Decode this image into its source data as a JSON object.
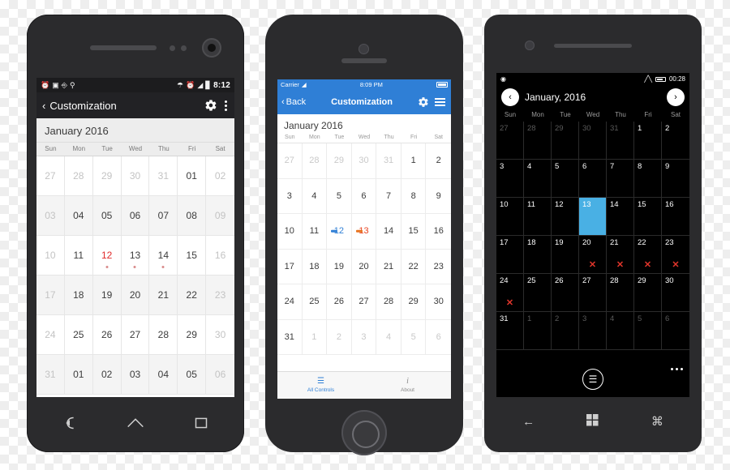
{
  "android": {
    "status": {
      "icons": [
        "alarm-clock-icon",
        "sd-card-icon",
        "android-icon",
        "location-icon"
      ],
      "right_icons": [
        "bluetooth-icon",
        "alarm-icon",
        "wifi-icon",
        "battery-icon"
      ],
      "clock": "8:12"
    },
    "actionbar": {
      "back_glyph": "‹",
      "title": "Customization",
      "gear_icon": "gear-icon",
      "overflow_icon": "overflow-menu-icon"
    },
    "month_header": "January 2016",
    "dow": [
      "Sun",
      "Mon",
      "Tue",
      "Wed",
      "Thu",
      "Fri",
      "Sat"
    ],
    "nav_icons": [
      "back-icon",
      "home-icon",
      "recents-icon"
    ],
    "weeks": [
      [
        {
          "d": "27",
          "state": "dim"
        },
        {
          "d": "28",
          "state": "dim"
        },
        {
          "d": "29",
          "state": "dim"
        },
        {
          "d": "30",
          "state": "dim"
        },
        {
          "d": "31",
          "state": "dim"
        },
        {
          "d": "01",
          "state": "normal"
        },
        {
          "d": "02",
          "state": "dim"
        }
      ],
      [
        {
          "d": "03",
          "state": "dim"
        },
        {
          "d": "04",
          "state": "normal"
        },
        {
          "d": "05",
          "state": "normal"
        },
        {
          "d": "06",
          "state": "normal"
        },
        {
          "d": "07",
          "state": "normal"
        },
        {
          "d": "08",
          "state": "normal"
        },
        {
          "d": "09",
          "state": "dim"
        }
      ],
      [
        {
          "d": "10",
          "state": "dim"
        },
        {
          "d": "11",
          "state": "normal"
        },
        {
          "d": "12",
          "state": "red",
          "marker": true
        },
        {
          "d": "13",
          "state": "normal",
          "marker": true
        },
        {
          "d": "14",
          "state": "normal",
          "marker": true
        },
        {
          "d": "15",
          "state": "normal"
        },
        {
          "d": "16",
          "state": "dim"
        }
      ],
      [
        {
          "d": "17",
          "state": "dim"
        },
        {
          "d": "18",
          "state": "normal"
        },
        {
          "d": "19",
          "state": "normal"
        },
        {
          "d": "20",
          "state": "normal"
        },
        {
          "d": "21",
          "state": "normal"
        },
        {
          "d": "22",
          "state": "normal"
        },
        {
          "d": "23",
          "state": "dim"
        }
      ],
      [
        {
          "d": "24",
          "state": "dim"
        },
        {
          "d": "25",
          "state": "normal"
        },
        {
          "d": "26",
          "state": "normal"
        },
        {
          "d": "27",
          "state": "normal"
        },
        {
          "d": "28",
          "state": "normal"
        },
        {
          "d": "29",
          "state": "normal"
        },
        {
          "d": "30",
          "state": "dim"
        }
      ],
      [
        {
          "d": "31",
          "state": "dim"
        },
        {
          "d": "01",
          "state": "normal"
        },
        {
          "d": "02",
          "state": "normal"
        },
        {
          "d": "03",
          "state": "normal"
        },
        {
          "d": "04",
          "state": "normal"
        },
        {
          "d": "05",
          "state": "normal"
        },
        {
          "d": "06",
          "state": "dim"
        }
      ]
    ]
  },
  "iphone": {
    "status": {
      "carrier": "Carrier",
      "wifi_icon": "wifi-icon",
      "clock": "8:09 PM",
      "battery_icon": "battery-full-icon"
    },
    "navbar": {
      "back_glyph": "‹",
      "back_label": "Back",
      "title": "Customization",
      "gear_icon": "gear-icon",
      "menu_icon": "hamburger-menu-icon"
    },
    "month_header": "January 2016",
    "dow": [
      "Sun",
      "Mon",
      "Tue",
      "Wed",
      "Thu",
      "Fri",
      "Sat"
    ],
    "tabs": [
      {
        "label": "All Controls",
        "icon": "list-icon",
        "selected": true
      },
      {
        "label": "About",
        "icon": "info-icon",
        "selected": false
      }
    ],
    "colors": {
      "accent": "#2f7fd6",
      "blue_bar": "#2f7fd6",
      "orange_bar": "#e8731f",
      "red_text": "#e8431f"
    },
    "weeks": [
      [
        {
          "d": "27",
          "state": "dim"
        },
        {
          "d": "28",
          "state": "dim"
        },
        {
          "d": "29",
          "state": "dim"
        },
        {
          "d": "30",
          "state": "dim"
        },
        {
          "d": "31",
          "state": "dim"
        },
        {
          "d": "1",
          "state": "normal"
        },
        {
          "d": "2",
          "state": "normal"
        }
      ],
      [
        {
          "d": "3",
          "state": "normal"
        },
        {
          "d": "4",
          "state": "normal"
        },
        {
          "d": "5",
          "state": "normal"
        },
        {
          "d": "6",
          "state": "normal"
        },
        {
          "d": "7",
          "state": "normal"
        },
        {
          "d": "8",
          "state": "normal"
        },
        {
          "d": "9",
          "state": "normal"
        }
      ],
      [
        {
          "d": "10",
          "state": "normal"
        },
        {
          "d": "11",
          "state": "normal"
        },
        {
          "d": "12",
          "state": "bluetext",
          "bar": "#2f7fd6"
        },
        {
          "d": "13",
          "state": "redtext",
          "bar": "#e8731f"
        },
        {
          "d": "14",
          "state": "normal"
        },
        {
          "d": "15",
          "state": "normal"
        },
        {
          "d": "16",
          "state": "normal"
        }
      ],
      [
        {
          "d": "17",
          "state": "normal"
        },
        {
          "d": "18",
          "state": "normal"
        },
        {
          "d": "19",
          "state": "normal"
        },
        {
          "d": "20",
          "state": "normal"
        },
        {
          "d": "21",
          "state": "normal"
        },
        {
          "d": "22",
          "state": "normal"
        },
        {
          "d": "23",
          "state": "normal"
        }
      ],
      [
        {
          "d": "24",
          "state": "normal"
        },
        {
          "d": "25",
          "state": "normal"
        },
        {
          "d": "26",
          "state": "normal"
        },
        {
          "d": "27",
          "state": "normal"
        },
        {
          "d": "28",
          "state": "normal"
        },
        {
          "d": "29",
          "state": "normal"
        },
        {
          "d": "30",
          "state": "normal"
        }
      ],
      [
        {
          "d": "31",
          "state": "normal"
        },
        {
          "d": "1",
          "state": "dim"
        },
        {
          "d": "2",
          "state": "dim"
        },
        {
          "d": "3",
          "state": "dim"
        },
        {
          "d": "4",
          "state": "dim"
        },
        {
          "d": "5",
          "state": "dim"
        },
        {
          "d": "6",
          "state": "dim"
        }
      ]
    ]
  },
  "wphone": {
    "status": {
      "left_icon": "camera-icon",
      "signal_icon": "signal-icon",
      "battery_icon": "battery-icon",
      "clock": "00:28"
    },
    "header": {
      "prev_glyph": "‹",
      "title": "January, 2016",
      "next_glyph": "›"
    },
    "dow": [
      "Sun",
      "Mon",
      "Tue",
      "Wed",
      "Thu",
      "Fri",
      "Sat"
    ],
    "appbar": {
      "list_icon": "list-icon",
      "overflow_icon": "ellipsis-icon"
    },
    "nav_icons": [
      "back-arrow-icon",
      "windows-start-icon",
      "search-icon"
    ],
    "colors": {
      "selection": "#49b0e4",
      "marker_red": "#e0352b"
    },
    "weeks": [
      [
        {
          "d": "27",
          "state": "dim"
        },
        {
          "d": "28",
          "state": "dim"
        },
        {
          "d": "29",
          "state": "dim"
        },
        {
          "d": "30",
          "state": "dim"
        },
        {
          "d": "31",
          "state": "dim"
        },
        {
          "d": "1",
          "state": "normal"
        },
        {
          "d": "2",
          "state": "normal"
        }
      ],
      [
        {
          "d": "3",
          "state": "normal"
        },
        {
          "d": "4",
          "state": "normal"
        },
        {
          "d": "5",
          "state": "normal"
        },
        {
          "d": "6",
          "state": "normal"
        },
        {
          "d": "7",
          "state": "normal"
        },
        {
          "d": "8",
          "state": "normal"
        },
        {
          "d": "9",
          "state": "normal"
        }
      ],
      [
        {
          "d": "10",
          "state": "normal"
        },
        {
          "d": "11",
          "state": "normal"
        },
        {
          "d": "12",
          "state": "normal"
        },
        {
          "d": "13",
          "state": "sel"
        },
        {
          "d": "14",
          "state": "normal"
        },
        {
          "d": "15",
          "state": "normal"
        },
        {
          "d": "16",
          "state": "normal"
        }
      ],
      [
        {
          "d": "17",
          "state": "normal"
        },
        {
          "d": "18",
          "state": "normal"
        },
        {
          "d": "19",
          "state": "normal"
        },
        {
          "d": "20",
          "state": "normal",
          "mark": "✕"
        },
        {
          "d": "21",
          "state": "normal",
          "mark": "✕"
        },
        {
          "d": "22",
          "state": "normal",
          "mark": "✕"
        },
        {
          "d": "23",
          "state": "normal",
          "mark": "✕"
        }
      ],
      [
        {
          "d": "24",
          "state": "normal",
          "mark": "✕"
        },
        {
          "d": "25",
          "state": "normal"
        },
        {
          "d": "26",
          "state": "normal"
        },
        {
          "d": "27",
          "state": "normal"
        },
        {
          "d": "28",
          "state": "normal"
        },
        {
          "d": "29",
          "state": "normal"
        },
        {
          "d": "30",
          "state": "normal"
        }
      ],
      [
        {
          "d": "31",
          "state": "normal"
        },
        {
          "d": "1",
          "state": "dim"
        },
        {
          "d": "2",
          "state": "dim"
        },
        {
          "d": "3",
          "state": "dim"
        },
        {
          "d": "4",
          "state": "dim"
        },
        {
          "d": "5",
          "state": "dim"
        },
        {
          "d": "6",
          "state": "dim"
        }
      ]
    ]
  }
}
